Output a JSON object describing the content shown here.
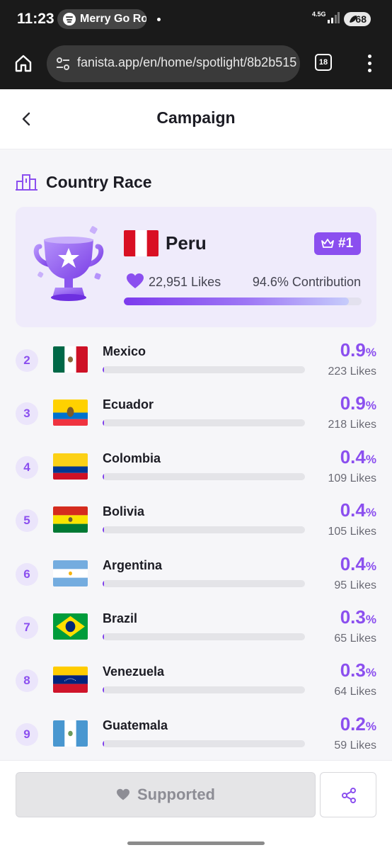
{
  "status_bar": {
    "time": "11:23",
    "media": "Merry Go Ro",
    "network": "4.5G",
    "battery": "68"
  },
  "browser": {
    "url": "fanista.app/en/home/spotlight/8b2b515",
    "tab_count": "18"
  },
  "header": {
    "title": "Campaign"
  },
  "section": {
    "title": "Country Race"
  },
  "leader": {
    "name": "Peru",
    "rank": "#1",
    "likes": "22,951 Likes",
    "contribution": "94.6% Contribution",
    "share": 0.946
  },
  "rankings": [
    {
      "rank": "2",
      "country": "Mexico",
      "percent": "0.9",
      "likes": "223 Likes",
      "share": 0.009
    },
    {
      "rank": "3",
      "country": "Ecuador",
      "percent": "0.9",
      "likes": "218 Likes",
      "share": 0.009
    },
    {
      "rank": "4",
      "country": "Colombia",
      "percent": "0.4",
      "likes": "109 Likes",
      "share": 0.004
    },
    {
      "rank": "5",
      "country": "Bolivia",
      "percent": "0.4",
      "likes": "105 Likes",
      "share": 0.004
    },
    {
      "rank": "6",
      "country": "Argentina",
      "percent": "0.4",
      "likes": "95 Likes",
      "share": 0.004
    },
    {
      "rank": "7",
      "country": "Brazil",
      "percent": "0.3",
      "likes": "65 Likes",
      "share": 0.003
    },
    {
      "rank": "8",
      "country": "Venezuela",
      "percent": "0.3",
      "likes": "64 Likes",
      "share": 0.003
    },
    {
      "rank": "9",
      "country": "Guatemala",
      "percent": "0.2",
      "likes": "59 Likes",
      "share": 0.002
    }
  ],
  "percent_sign": "%",
  "footer": {
    "supported_label": "Supported"
  },
  "colors": {
    "accent": "#8b4fef",
    "accent_soft": "#ebe5fb",
    "card_bg": "#efebfb"
  },
  "icons": {
    "back": "chevron-left-icon",
    "section": "podium-icon",
    "trophy": "trophy-icon",
    "rank_badge": "crown-icon",
    "likes": "heart-icon",
    "share": "share-icon"
  }
}
